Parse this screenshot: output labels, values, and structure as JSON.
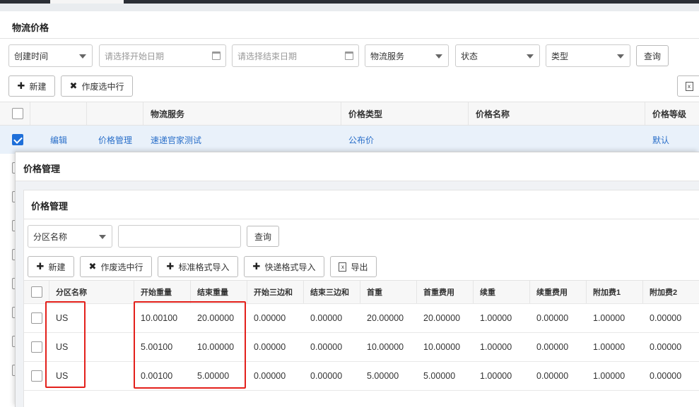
{
  "page": {
    "title": "物流价格"
  },
  "filters": {
    "create_time": "创建时间",
    "start_date_placeholder": "请选择开始日期",
    "end_date_placeholder": "请选择结束日期",
    "logistics_service": "物流服务",
    "status": "状态",
    "type": "类型",
    "query_label": "查询"
  },
  "toolbar": {
    "new_label": "新建",
    "void_label": "作废选中行"
  },
  "outer_table": {
    "headers": [
      "物流服务",
      "价格类型",
      "价格名称",
      "价格等级"
    ],
    "selected_row": {
      "edit": "编辑",
      "price_mgmt": "价格管理",
      "service": "速递官家测试",
      "price_type": "公布价",
      "price_name": "",
      "price_level": "默认"
    }
  },
  "modal": {
    "title": "价格管理",
    "inner_title": "价格管理",
    "filter_select": "分区名称",
    "filter_input_value": "",
    "query_label": "查询",
    "toolbar": {
      "new_label": "新建",
      "void_label": "作废选中行",
      "std_import_label": "标准格式导入",
      "express_import_label": "快递格式导入",
      "export_label": "导出"
    },
    "table": {
      "headers": [
        "分区名称",
        "开始重量",
        "结束重量",
        "开始三边和",
        "结束三边和",
        "首重",
        "首重费用",
        "续重",
        "续重费用",
        "附加费1",
        "附加费2"
      ],
      "rows": [
        [
          "US",
          "10.00100",
          "20.00000",
          "0.00000",
          "0.00000",
          "20.00000",
          "20.00000",
          "1.00000",
          "0.00000",
          "1.00000",
          "0.00000"
        ],
        [
          "US",
          "5.00100",
          "10.00000",
          "0.00000",
          "0.00000",
          "10.00000",
          "10.00000",
          "1.00000",
          "0.00000",
          "1.00000",
          "0.00000"
        ],
        [
          "US",
          "0.00100",
          "5.00000",
          "0.00000",
          "0.00000",
          "5.00000",
          "5.00000",
          "1.00000",
          "0.00000",
          "1.00000",
          "0.00000"
        ]
      ]
    }
  },
  "colors": {
    "link": "#2a6fc9",
    "checkbox_active": "#1e6fd9",
    "highlight_box": "#e3201b",
    "selected_row_bg": "#e9f1fa"
  },
  "icons": {
    "calendar": "calendar-icon",
    "caret": "chevron-down-icon",
    "plus": "plus-icon",
    "close": "close-icon",
    "export": "export-icon"
  }
}
